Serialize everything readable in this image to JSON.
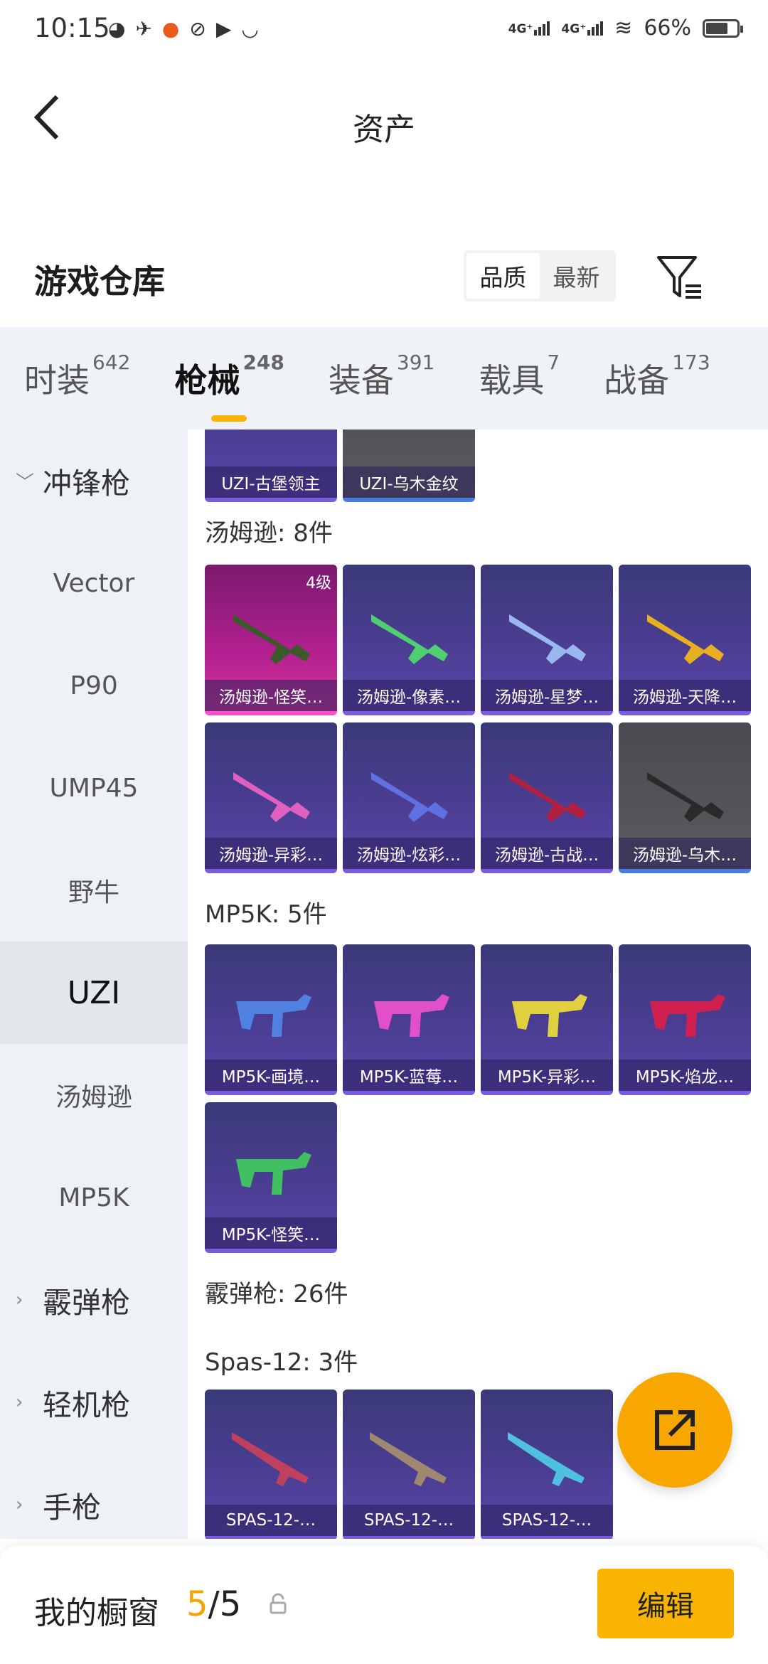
{
  "status": {
    "time": "10:15",
    "net1": "4G⁺",
    "net2": "4G⁺",
    "battery": "66%"
  },
  "nav": {
    "title": "资产"
  },
  "warehouse": {
    "title": "游戏仓库",
    "sort": [
      "品质",
      "最新"
    ]
  },
  "categories": [
    {
      "label": "时装",
      "count": "642"
    },
    {
      "label": "枪械",
      "count": "248"
    },
    {
      "label": "装备",
      "count": "391"
    },
    {
      "label": "载具",
      "count": "7"
    },
    {
      "label": "战备",
      "count": "173"
    }
  ],
  "sidebar": [
    "冲锋枪",
    "Vector",
    "P90",
    "UMP45",
    "野牛",
    "UZI",
    "汤姆逊",
    "MP5K",
    "霰弹枪",
    "轻机枪",
    "手枪"
  ],
  "sections": {
    "thompson": "汤姆逊: 8件",
    "mp5k": "MP5K: 5件",
    "shotgun": "霰弹枪: 26件",
    "spas": "Spas-12: 3件"
  },
  "items": {
    "uzi": [
      "UZI-古堡领主",
      "UZI-乌木金纹"
    ],
    "thompson": [
      "汤姆逊-怪笑…",
      "汤姆逊-像素…",
      "汤姆逊-星梦…",
      "汤姆逊-天降…",
      "汤姆逊-异彩…",
      "汤姆逊-炫彩…",
      "汤姆逊-古战…",
      "汤姆逊-乌木…"
    ],
    "thompson_level": "4级",
    "mp5k": [
      "MP5K-画境…",
      "MP5K-蓝莓…",
      "MP5K-异彩…",
      "MP5K-焰龙…",
      "MP5K-怪笑…"
    ],
    "spas": [
      "SPAS-12-…",
      "SPAS-12-…",
      "SPAS-12-…"
    ]
  },
  "showcase": {
    "label": "我的橱窗",
    "current": "5",
    "total": "/5",
    "edit": "编辑"
  },
  "colors": {
    "accent": "#f8b400",
    "tile": "#4a3d92",
    "pink_tile": "#b22090",
    "gray_tile": "#5a5a60"
  }
}
